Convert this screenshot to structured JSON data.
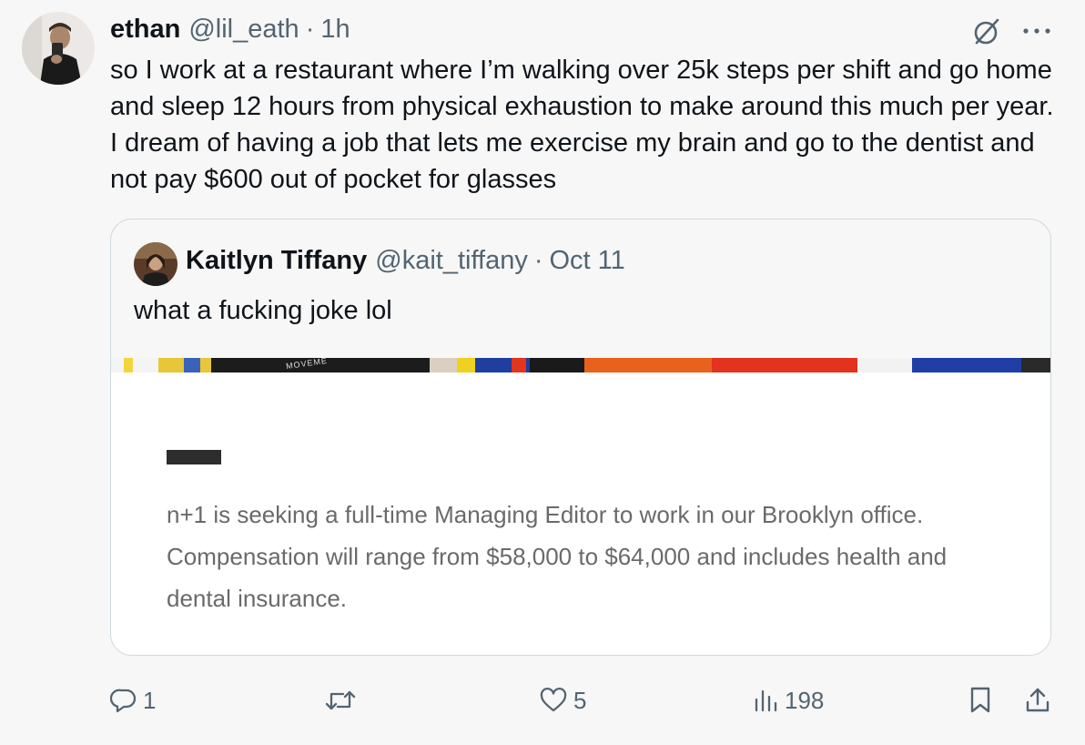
{
  "tweet": {
    "author": {
      "name": "ethan",
      "handle": "@lil_eath",
      "timestamp": "1h"
    },
    "text": "so I work at a restaurant where I’m walking over 25k steps per shift and go home and sleep 12 hours from physical exhaustion to make around this much per year. I dream of having a job that lets me exercise my brain and go to the dentist and not pay $600 out of pocket for glasses",
    "header_icons": [
      "grok-icon",
      "more-icon"
    ],
    "separator": "·"
  },
  "quoted_tweet": {
    "author": {
      "name": "Kaitlyn Tiffany",
      "handle": "@kait_tiffany",
      "timestamp": "Oct 11"
    },
    "text": "what a fucking joke lol",
    "media": {
      "banner_text": "MOVEME",
      "text": "n+1 is seeking a full-time Managing Editor to work in our Brooklyn office. Compensation will range from $58,000 to $64,000 and includes health and dental insurance."
    }
  },
  "actions": {
    "reply": {
      "icon": "reply-icon",
      "count": "1"
    },
    "retweet": {
      "icon": "retweet-icon",
      "count": ""
    },
    "like": {
      "icon": "heart-icon",
      "count": "5"
    },
    "views": {
      "icon": "views-icon",
      "count": "198"
    },
    "bookmark": {
      "icon": "bookmark-icon"
    },
    "share": {
      "icon": "share-icon"
    }
  },
  "colors": {
    "background": "#f7f7f7",
    "text": "#0f1419",
    "muted": "#536471",
    "border": "#cfd9de"
  }
}
